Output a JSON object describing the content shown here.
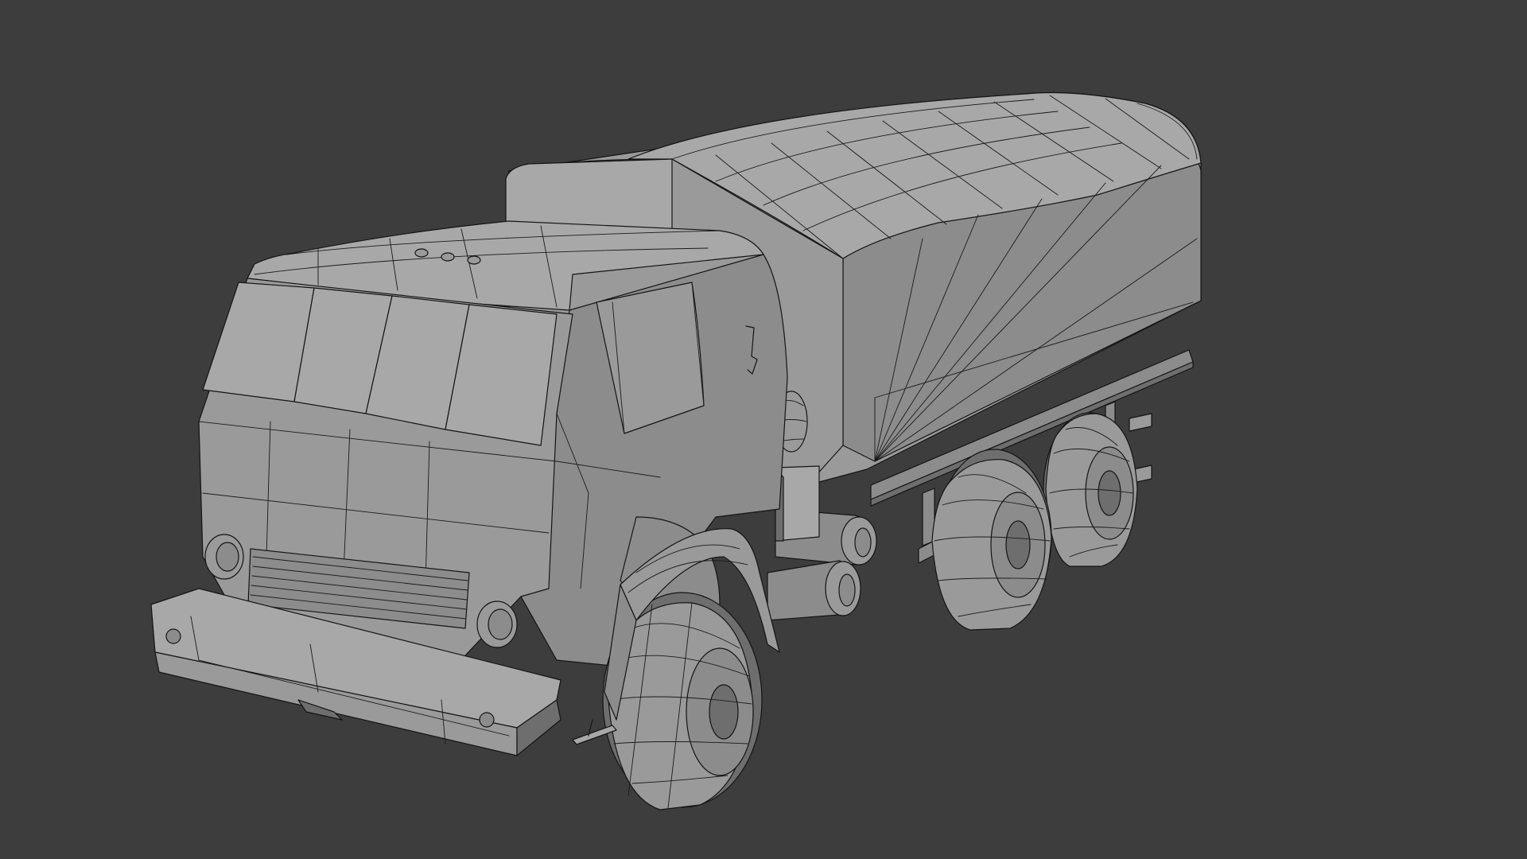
{
  "viewport": {
    "background": "#3d3d3d",
    "model_color": "#9a9a9a",
    "wire_color": "#141414",
    "subject": "truck-model"
  }
}
